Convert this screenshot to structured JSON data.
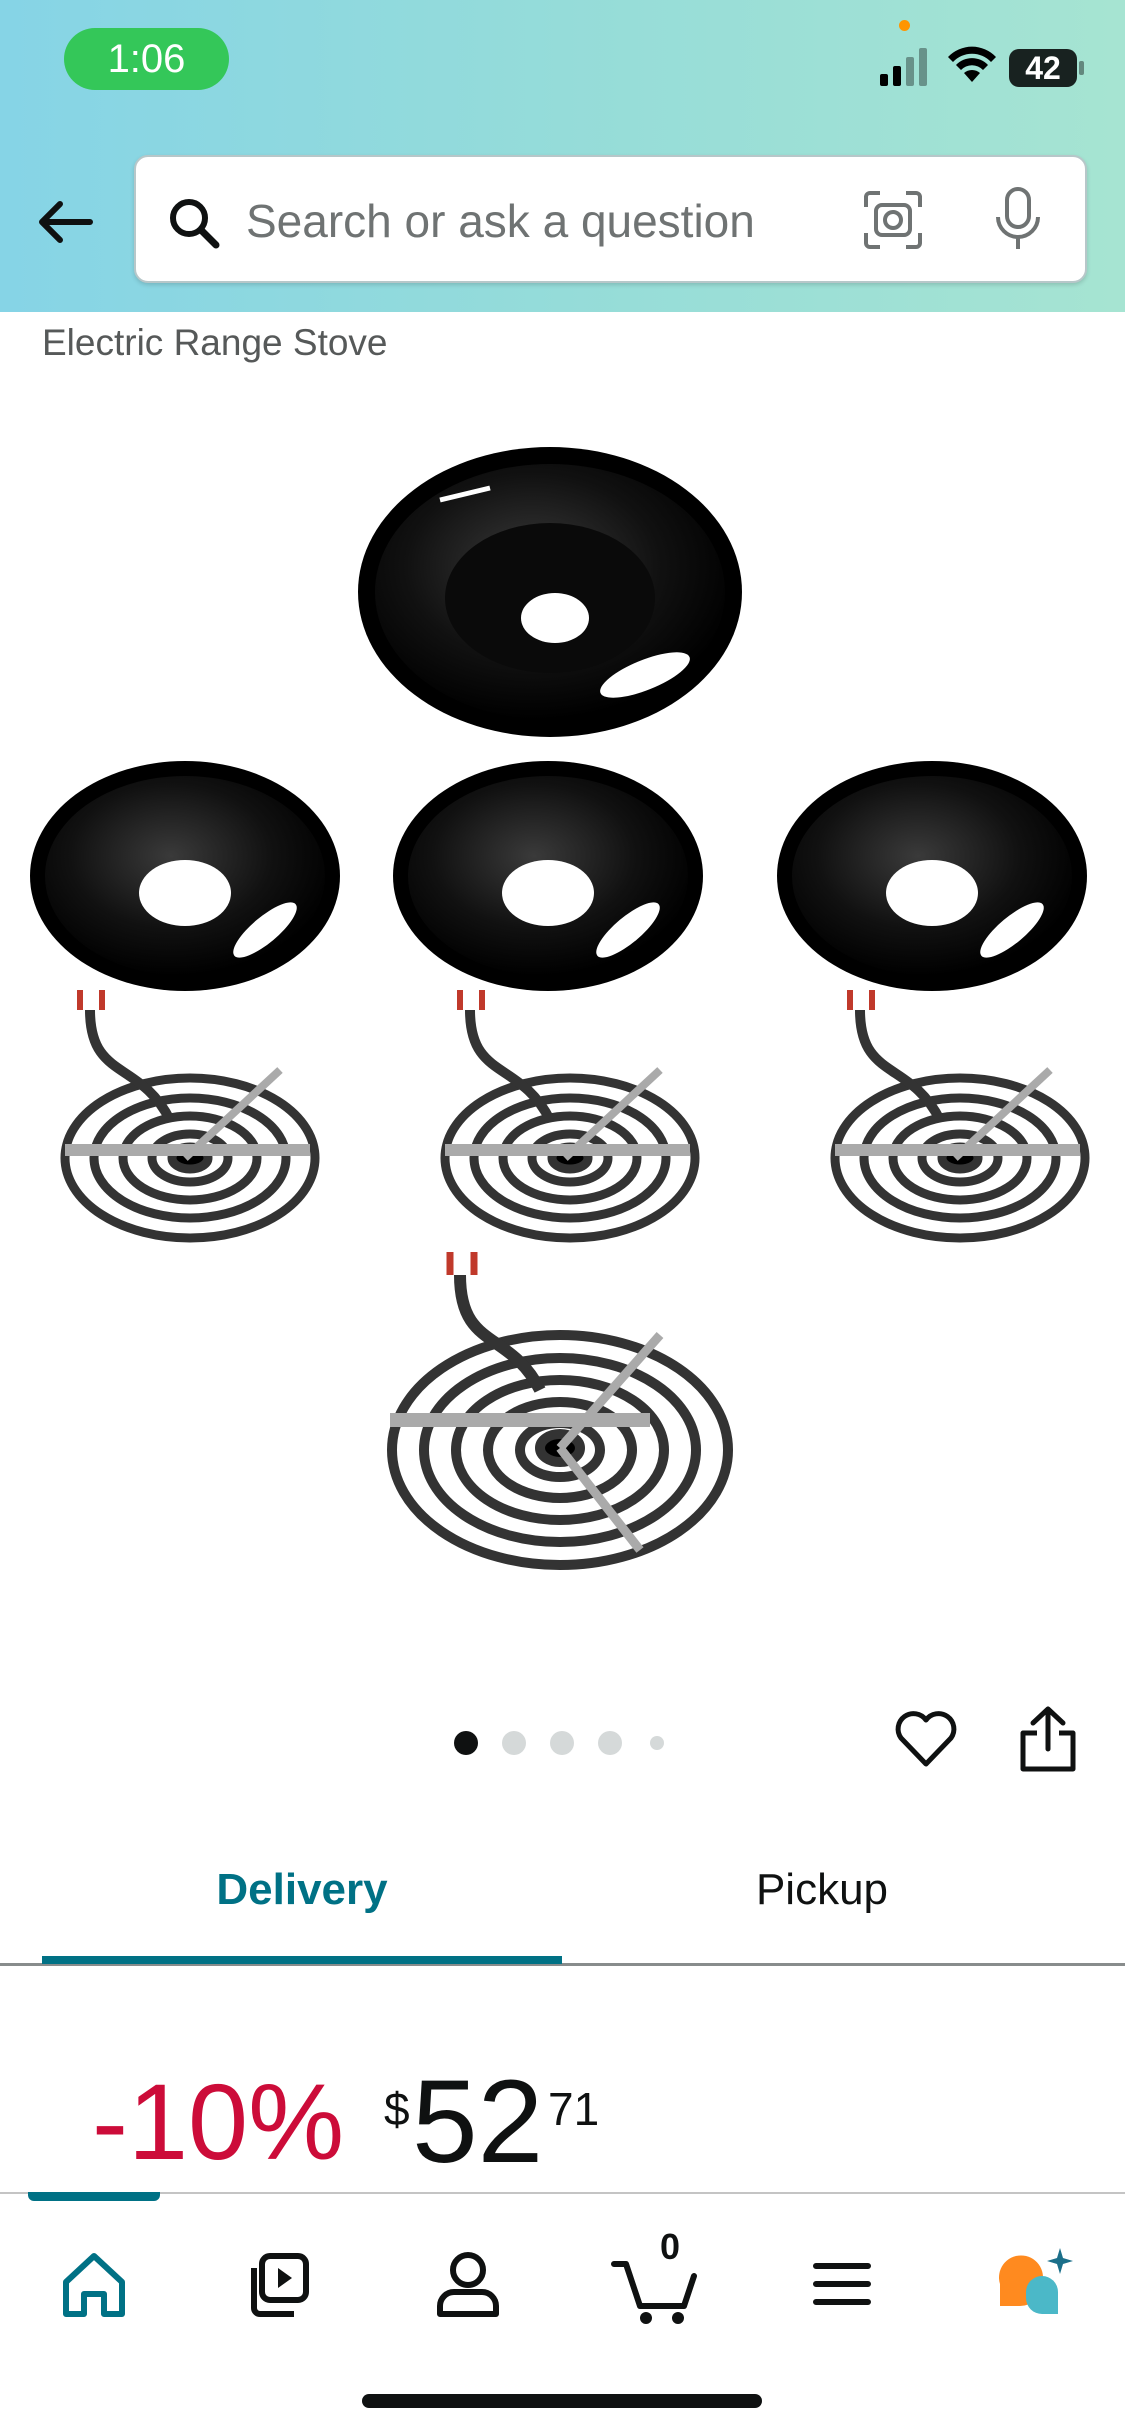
{
  "status_bar": {
    "time": "1:06",
    "battery": "42"
  },
  "search": {
    "placeholder": "Search or ask a question"
  },
  "product": {
    "title_visible": "Electric Range Stove"
  },
  "gallery": {
    "current_index": 1,
    "dot_count": 5
  },
  "tabs": {
    "delivery": "Delivery",
    "pickup": "Pickup",
    "active": "Delivery"
  },
  "price": {
    "discount": "-10%",
    "currency": "$",
    "whole": "52",
    "fraction": "71"
  },
  "bottom_nav": {
    "cart_count": "0",
    "active": "home",
    "items": [
      "home-icon",
      "video-icon",
      "account-icon",
      "cart-icon",
      "menu-icon",
      "rufus-icon"
    ]
  },
  "colors": {
    "accent_teal": "#007185",
    "discount_red": "#cc0c39",
    "status_green": "#34c759"
  }
}
